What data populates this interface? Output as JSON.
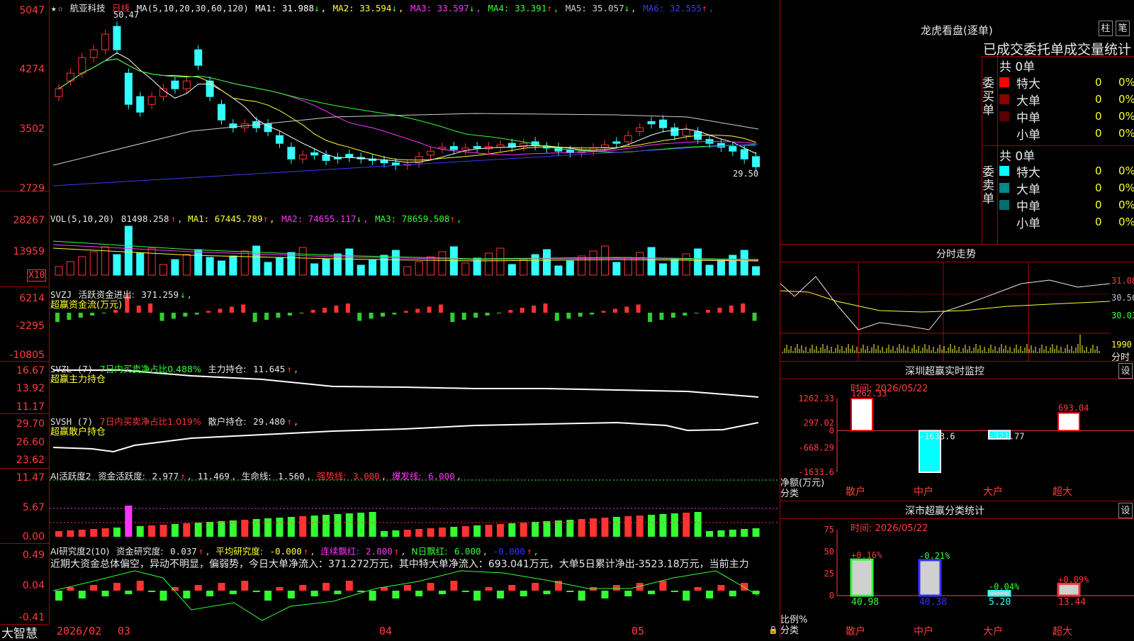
{
  "stock": {
    "name": "航亚科技",
    "period": "日线",
    "ma_header": "MA(5,10,20,30,60,120)",
    "ma": [
      {
        "label": "MA1:",
        "value": "31.988",
        "arrow": "↓",
        "color": "#ffffff"
      },
      {
        "label": "MA2:",
        "value": "33.594",
        "arrow": "↓",
        "color": "#ffff33"
      },
      {
        "label": "MA3:",
        "value": "33.597",
        "arrow": "↓",
        "color": "#ff33ff"
      },
      {
        "label": "MA4:",
        "value": "33.391",
        "arrow": "↑",
        "color": "#33ff33"
      },
      {
        "label": "MA5:",
        "value": "35.057",
        "arrow": "↓",
        "color": "#cfcfcf"
      },
      {
        "label": "MA6:",
        "value": "32.555",
        "arrow": "↑",
        "color": "#3a3aff"
      }
    ],
    "high_label": "50.47",
    "low_label": "29.50",
    "y_ticks": [
      "5047",
      "4274",
      "3502",
      "2729"
    ]
  },
  "vol": {
    "header": "VOL(5,10,20)",
    "value": "81498.258",
    "ma": [
      {
        "label": "MA1:",
        "value": "67445.789",
        "arrow": "↑",
        "color": "#ffff33"
      },
      {
        "label": "MA2:",
        "value": "74655.117",
        "arrow": "↓",
        "color": "#ff33ff"
      },
      {
        "label": "MA3:",
        "value": "78659.508",
        "arrow": "↑",
        "color": "#33ff33"
      }
    ],
    "y_ticks": [
      "28267",
      "13959"
    ],
    "unit": "X10"
  },
  "svzj": {
    "header": "SVZJ",
    "label": "活跃资金进出:",
    "value": "371.259",
    "arrow": "↓",
    "subtitle": "超赢资金流(万元)",
    "y_ticks": [
      "6214",
      "-2295",
      "-10805"
    ]
  },
  "svzl": {
    "header": "SVZL (7)",
    "label": "7日内买卖净占比0.488%",
    "label2": "主力持仓:",
    "value": "11.645",
    "arrow": "↑",
    "subtitle": "超赢主力持仓",
    "y_ticks": [
      "16.67",
      "13.92",
      "11.17"
    ]
  },
  "svsh": {
    "header": "SVSH (7)",
    "label": "7日内买卖净占比1.019%",
    "label2": "散户持仓:",
    "value": "29.480",
    "arrow": "↑",
    "subtitle": "超赢散户持仓",
    "y_ticks": [
      "29.70",
      "26.60",
      "23.62"
    ]
  },
  "ai1": {
    "header": "AI活跃度2",
    "label": "资金活跃度:",
    "value": "2.977",
    "arrow": "↑",
    "value2": "11.469",
    "label3": "生命线:",
    "value3": "1.560",
    "label4": "强势线:",
    "value4": "3.000",
    "label5": "爆发线:",
    "value5": "6.000",
    "y_ticks": [
      "11.47",
      "5.67",
      "0.00"
    ]
  },
  "ai2": {
    "header": "AI研究度2(10)",
    "label": "资金研究度:",
    "value": "0.037",
    "arrow": "↑",
    "label2": "平均研究度:",
    "value2": "-0.000",
    "label3": "连续飘红:",
    "value3": "2.000",
    "label4": "N日飘红:",
    "value4": "6.000",
    "value5": "-0.000",
    "comment": "近期大资金总体偏空，异动不明显，偏弱势，今日大单净流入：371.272万元，其中特大单净流入：693.041万元，大单5日累计净出-3523.18万元，当前主力",
    "y_ticks": [
      "0.49",
      "0.04",
      "-0.41"
    ]
  },
  "xaxis": {
    "labels": [
      "2026/02",
      "03",
      "04",
      "05"
    ],
    "brand": "大智慧"
  },
  "lhb": {
    "title": "龙虎看盘(逐单)",
    "btn1": "柱",
    "btn2": "笔",
    "subtitle": "已成交委托单成交量统计",
    "buy_side": "委买单",
    "sell_side": "委卖单",
    "buy_total": "共 0单",
    "sell_total": "共 0单",
    "buy_rows": [
      {
        "label": "特大",
        "count": "0",
        "pct": "0%",
        "color": "#ff0000"
      },
      {
        "label": "大单",
        "count": "0",
        "pct": "0%",
        "color": "#8b0000"
      },
      {
        "label": "中单",
        "count": "0",
        "pct": "0%",
        "color": "#5a0000"
      },
      {
        "label": "小单",
        "count": "0",
        "pct": "0%",
        "color": "#000000"
      }
    ],
    "sell_rows": [
      {
        "label": "特大",
        "count": "0",
        "pct": "0%",
        "color": "#00ffff"
      },
      {
        "label": "大单",
        "count": "0",
        "pct": "0%",
        "color": "#008b8b"
      },
      {
        "label": "中单",
        "count": "0",
        "pct": "0%",
        "color": "#007070"
      },
      {
        "label": "小单",
        "count": "0",
        "pct": "0%",
        "color": "#000000"
      }
    ]
  },
  "intraday": {
    "title": "分时走势",
    "y_ticks": [
      "31.08",
      "30.56",
      "30.03"
    ],
    "vol_tick": "1990",
    "unit": "分时"
  },
  "monitor": {
    "title": "深圳超赢实时监控",
    "settings": "设",
    "time": "时间: 2026/05/22",
    "ylabel": "净额(万元)",
    "xlabel": "分类",
    "y_ticks": [
      "1262.33",
      "297.02",
      "0",
      "-668.29",
      "-1633.6"
    ],
    "ylim": [
      -1633.6,
      1262.33
    ],
    "categories": [
      "散户",
      "中户",
      "大户",
      "超大"
    ],
    "values": [
      1262.33,
      -1633.6,
      -321.77,
      693.04
    ],
    "value_labels": [
      "1262.33",
      "-1633.6",
      "-321.77",
      "693.04"
    ],
    "bar_colors": [
      "#ffffff",
      "#00ffff",
      "#00ffff",
      "#ffffff"
    ],
    "edge_colors": [
      "#ff0000",
      "#ffffff",
      "#ffffff",
      "#ff0000"
    ]
  },
  "classify": {
    "title": "深市超赢分类统计",
    "settings": "设",
    "time": "时间: 2026/05/22",
    "ylabel": "比例%",
    "xlabel": "分类",
    "y_ticks": [
      "75",
      "50",
      "25",
      "0"
    ],
    "ylim": [
      0,
      75
    ],
    "categories": [
      "散户",
      "中户",
      "大户",
      "超大"
    ],
    "values": [
      40.98,
      40.38,
      5.2,
      13.44
    ],
    "value_labels": [
      "40.98",
      "40.38",
      "5.20",
      "13.44"
    ],
    "change_labels": [
      "+0.16%",
      "-0.21%",
      "-0.04%",
      "+0.09%"
    ],
    "change_colors": [
      "#ff3333",
      "#33ff33",
      "#33ff33",
      "#ff3333"
    ],
    "bar_colors": [
      "#33ff33",
      "#3333ff",
      "#33ffff",
      "#ff3333"
    ]
  }
}
